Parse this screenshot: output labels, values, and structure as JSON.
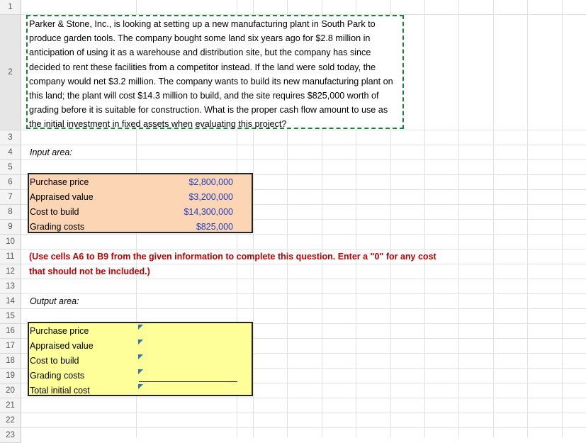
{
  "rows": [
    "1",
    "2",
    "3",
    "4",
    "5",
    "6",
    "7",
    "8",
    "9",
    "10",
    "11",
    "12",
    "13",
    "14",
    "15",
    "16",
    "17",
    "18",
    "19",
    "20",
    "21",
    "22",
    "23"
  ],
  "problem_text": "Parker & Stone, Inc., is looking at setting up a new manufacturing plant in South Park to produce garden tools. The company bought some land six years ago for $2.8 million in anticipation of using it as a warehouse and distribution site, but the company has since decided to rent these facilities from a competitor instead. If the land were sold today, the company would net $3.2 million. The company wants to build its new manufacturing plant on this land; the plant will cost $14.3 million to build, and the site requires $825,000 worth of grading before it is suitable for construction. What is the proper cash flow amount to use as the initial investment in fixed assets when evaluating this project?",
  "input_area_label": "Input area:",
  "inputs": [
    {
      "label": "Purchase price",
      "value": "$2,800,000"
    },
    {
      "label": "Appraised value",
      "value": "$3,200,000"
    },
    {
      "label": "Cost to build",
      "value": "$14,300,000"
    },
    {
      "label": "Grading costs",
      "value": "$825,000"
    }
  ],
  "instruction_line1": "(Use cells A6 to B9 from the given information to complete this question. Enter a \"0\" for any cost",
  "instruction_line2": "that should not be included.)",
  "output_area_label": "Output area:",
  "outputs": [
    {
      "label": "Purchase price"
    },
    {
      "label": "Appraised value"
    },
    {
      "label": "Cost to build"
    },
    {
      "label": "Grading costs"
    },
    {
      "label": "Total initial cost"
    }
  ],
  "colors": {
    "input_fill": "#fcd5b4",
    "output_fill": "#ffff99",
    "value_blue": "#1f3fbf",
    "note_red": "#c00000",
    "marker_blue": "#2e75b6"
  }
}
